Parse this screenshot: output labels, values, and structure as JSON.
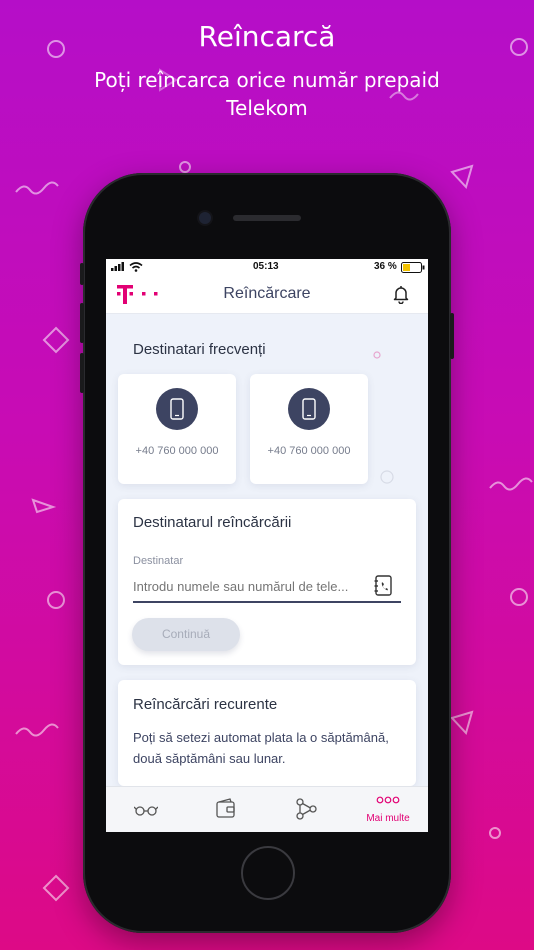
{
  "promo": {
    "title": "Reîncarcă",
    "subtitle": "Poți reîncarca orice număr prepaid Telekom"
  },
  "status_bar": {
    "time": "05:13",
    "battery": "36 %"
  },
  "app_bar": {
    "title": "Reîncărcare",
    "logo": "T · ·"
  },
  "frequent": {
    "title": "Destinatari frecvenți",
    "items": [
      {
        "number": "+40 760 000 000"
      },
      {
        "number": "+40 760 000 000"
      }
    ]
  },
  "recipient": {
    "title": "Destinatarul reîncărcării",
    "field_label": "Destinatar",
    "placeholder": "Introdu numele sau numărul de tele...",
    "value": "",
    "continue_label": "Continuă"
  },
  "recurring": {
    "title": "Reîncărcări recurente",
    "text": "Poți să setezi automat plata la o săptămână, două săptămâni sau lunar."
  },
  "tabs": [
    {
      "icon": "glasses-icon",
      "label": ""
    },
    {
      "icon": "wallet-icon",
      "label": ""
    },
    {
      "icon": "network-icon",
      "label": ""
    },
    {
      "icon": "more-dots-icon",
      "label": "Mai multe"
    }
  ],
  "colors": {
    "brand": "#e20074",
    "navy": "#3d4462",
    "bg_top": "#b50ec8",
    "bg_bottom": "#dd0a86"
  }
}
